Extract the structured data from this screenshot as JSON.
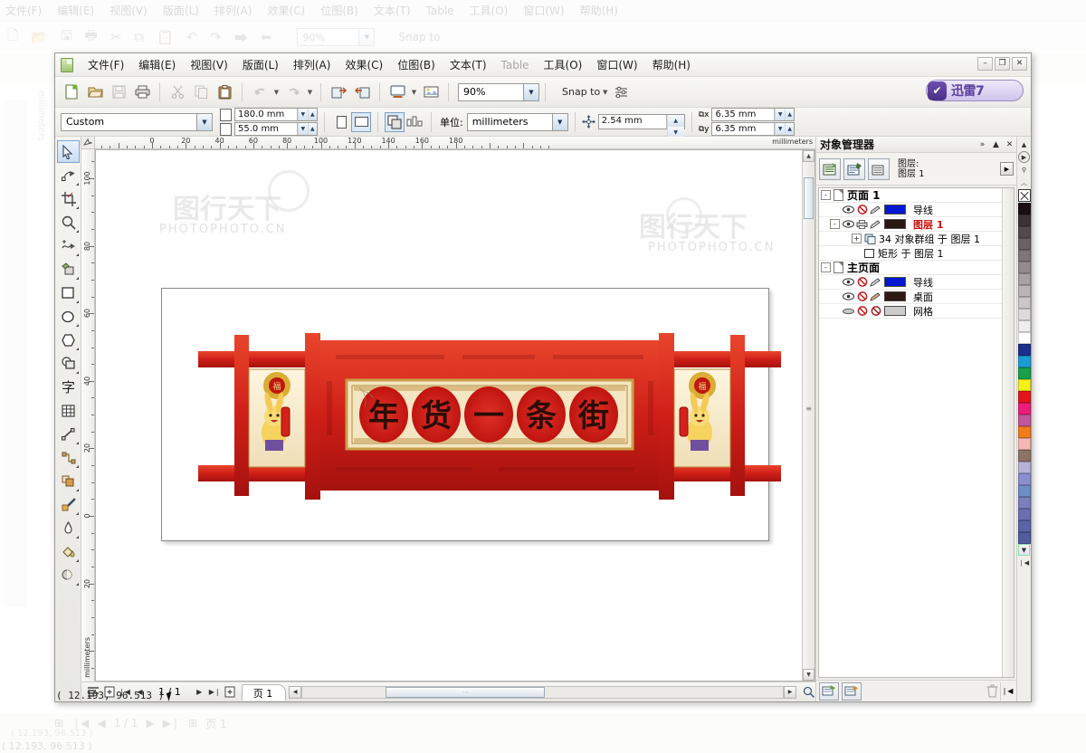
{
  "app": {
    "title_icon": "document-icon",
    "thunder_badge": {
      "text": "迅雷7",
      "mark": "✔"
    }
  },
  "menubar": {
    "items": [
      {
        "label": "文件(F)"
      },
      {
        "label": "编辑(E)"
      },
      {
        "label": "视图(V)"
      },
      {
        "label": "版面(L)"
      },
      {
        "label": "排列(A)"
      },
      {
        "label": "效果(C)"
      },
      {
        "label": "位图(B)"
      },
      {
        "label": "文本(T)"
      },
      {
        "label": "Table"
      },
      {
        "label": "工具(O)"
      },
      {
        "label": "窗口(W)"
      },
      {
        "label": "帮助(H)"
      }
    ],
    "window_buttons": [
      {
        "name": "minimize",
        "glyph": "–"
      },
      {
        "name": "restore",
        "glyph": "❐"
      },
      {
        "name": "close",
        "glyph": "✕"
      }
    ]
  },
  "toolbar": {
    "buttons": [
      {
        "name": "new-document-icon",
        "glyph": "🗋"
      },
      {
        "name": "open-document-icon",
        "glyph": "📂"
      },
      {
        "name": "save-icon",
        "glyph": "🖫"
      },
      {
        "name": "print-icon",
        "glyph": "🖶"
      },
      {
        "name": "cut-icon",
        "glyph": "✂"
      },
      {
        "name": "copy-icon",
        "glyph": "⧉"
      },
      {
        "name": "paste-icon",
        "glyph": "📋"
      },
      {
        "name": "undo-icon",
        "glyph": "↶"
      },
      {
        "name": "redo-icon",
        "glyph": "↷"
      },
      {
        "name": "import-icon",
        "glyph": "⮕"
      },
      {
        "name": "export-icon",
        "glyph": "⬅"
      },
      {
        "name": "application-launcher-icon",
        "glyph": "🖳"
      },
      {
        "name": "corel-online-icon",
        "glyph": "🖼"
      }
    ],
    "zoom_value": "90%",
    "snap_to_label": "Snap to",
    "options_icon": "options-icon"
  },
  "property_bar": {
    "paper_type": "Custom",
    "paper_width": "180.0 mm",
    "paper_height": "55.0 mm",
    "orientation_selected": "landscape",
    "units_label": "单位:",
    "units_value": "millimeters",
    "nudge_offset": "2.54 mm",
    "duplicate_x": "6.35 mm",
    "duplicate_y": "6.35 mm"
  },
  "toolbox": [
    {
      "name": "pick-tool",
      "glyph": "➤",
      "active": true,
      "flyout": false
    },
    {
      "name": "shape-tool",
      "glyph": "✥",
      "active": false,
      "flyout": true
    },
    {
      "name": "crop-tool",
      "glyph": "✂",
      "active": false,
      "flyout": true
    },
    {
      "name": "zoom-tool",
      "glyph": "🔍",
      "active": false,
      "flyout": true
    },
    {
      "name": "freehand-tool",
      "glyph": "✎",
      "active": false,
      "flyout": true
    },
    {
      "name": "smart-fill-tool",
      "glyph": "◈",
      "active": false,
      "flyout": true
    },
    {
      "name": "rectangle-tool",
      "glyph": "▭",
      "active": false,
      "flyout": true
    },
    {
      "name": "ellipse-tool",
      "glyph": "◯",
      "active": false,
      "flyout": true
    },
    {
      "name": "polygon-tool",
      "glyph": "⬡",
      "active": false,
      "flyout": true
    },
    {
      "name": "basic-shapes-tool",
      "glyph": "⬓",
      "active": false,
      "flyout": true
    },
    {
      "name": "text-tool",
      "glyph": "字",
      "active": false,
      "flyout": false
    },
    {
      "name": "table-tool",
      "glyph": "▦",
      "active": false,
      "flyout": false
    },
    {
      "name": "dimension-tool",
      "glyph": "⟋",
      "active": false,
      "flyout": true
    },
    {
      "name": "connector-tool",
      "glyph": "⌁",
      "active": false,
      "flyout": true
    },
    {
      "name": "blend-tool",
      "glyph": "❏",
      "active": false,
      "flyout": true
    },
    {
      "name": "eyedropper-tool",
      "glyph": "⚲",
      "active": false,
      "flyout": true
    },
    {
      "name": "outline-tool",
      "glyph": "✒",
      "active": false,
      "flyout": true
    },
    {
      "name": "fill-tool",
      "glyph": "🪣",
      "active": false,
      "flyout": true
    },
    {
      "name": "interactive-fill-tool",
      "glyph": "◐",
      "active": false,
      "flyout": true
    }
  ],
  "rulers": {
    "unit_label": "millimeters",
    "horizontal_ticks": [
      "0",
      "20",
      "40",
      "60",
      "80",
      "100",
      "120",
      "140",
      "160",
      "180"
    ],
    "vertical_ticks": [
      "100",
      "80",
      "60",
      "40",
      "20",
      "0",
      "20"
    ]
  },
  "artwork": {
    "title": "年货一条街",
    "characters": [
      "年",
      "货",
      "一",
      "条",
      "街"
    ],
    "description": "中国风红色年货一条街横幅，两侧兔子吉祥物"
  },
  "page_nav": {
    "first_label": "❘◀",
    "prev_label": "◀",
    "page_count": "1 / 1",
    "next_label": "▶",
    "last_label": "▶❘",
    "add_page_before_icon": "add-page-icon",
    "add_page_after_icon": "add-page-icon",
    "tab_label": "页 1"
  },
  "docker": {
    "title": "对象管理器",
    "header_buttons": [
      {
        "name": "docker-more",
        "glyph": "»"
      },
      {
        "name": "docker-collapse",
        "glyph": "▲"
      },
      {
        "name": "docker-close",
        "glyph": "✕"
      }
    ],
    "tool_buttons": [
      {
        "name": "show-object-properties-icon",
        "glyph": "▤"
      },
      {
        "name": "edit-across-layers-icon",
        "glyph": "▥"
      },
      {
        "name": "layer-manager-view-icon",
        "glyph": "▦"
      }
    ],
    "layer_caption_line1": "图层:",
    "layer_caption_line2": "图层 1",
    "expand_button": "▶",
    "tree": [
      {
        "name": "页面 1",
        "type": "page",
        "expander": "-",
        "children": [
          {
            "label": "导线",
            "type": "layer",
            "color": "#0018d0",
            "eye": "visible",
            "print": "no-print",
            "lock": "editable"
          },
          {
            "label": "图层 1",
            "type": "layer",
            "color": "#2a1612",
            "highlight": true,
            "eye": "visible",
            "print": "print",
            "lock": "editable",
            "children": [
              {
                "label": "34 对象群组 于 图层 1",
                "type": "group",
                "expander": "+"
              },
              {
                "label": "矩形 于 图层 1",
                "type": "rectangle"
              }
            ]
          }
        ]
      },
      {
        "name": "主页面",
        "type": "masterpage",
        "expander": "-",
        "children": [
          {
            "label": "导线",
            "type": "layer",
            "color": "#0018d0",
            "eye": "visible",
            "print": "no-print",
            "lock": "editable"
          },
          {
            "label": "桌面",
            "type": "layer",
            "color": "#2e1a12",
            "eye": "visible",
            "print": "no-print",
            "lock": "editable"
          },
          {
            "label": "网格",
            "type": "layer",
            "color": "#cccccc",
            "eye": "hidden",
            "print": "no-print",
            "lock": "locked"
          }
        ]
      }
    ],
    "footer_buttons": [
      {
        "name": "new-child-object-icon",
        "glyph": "▣"
      },
      {
        "name": "new-layer-icon",
        "glyph": "▤"
      }
    ],
    "delete_icon": "trash-icon",
    "collapse_icon": "❘◀"
  },
  "palette": {
    "top_buttons": [
      {
        "name": "palette-scroll-up-icon",
        "glyph": "▲"
      },
      {
        "name": "palette-menu-icon",
        "glyph": "▶"
      },
      {
        "name": "palette-pin-icon",
        "glyph": "⚲"
      },
      {
        "name": "palette-more-up-icon",
        "glyph": "︿"
      }
    ],
    "no-color": "none-swatch",
    "swatches": [
      "#1a1013",
      "#3c3336",
      "#55494c",
      "#6b6063",
      "#7f7579",
      "#938b8e",
      "#a7a1a3",
      "#b9b4b6",
      "#cbc8c9",
      "#dedbdc",
      "#efeeee",
      "#ffffff",
      "#1b2f8c",
      "#1c9ad6",
      "#17a04a",
      "#f5f018",
      "#e3141e",
      "#ec1c7a",
      "#c4559b",
      "#f07c1a",
      "#f6b8b5",
      "#8c7365",
      "#b7b3d8",
      "#8b8fd0",
      "#6d8ec6",
      "#7b7fbc",
      "#6a6fb1",
      "#5a64a8",
      "#4f5c9e"
    ],
    "scroll_down": "▼",
    "palette_home": "❘◀"
  },
  "status": {
    "coordinates": "( 12.193, 96.513 )"
  },
  "watermarks": [
    "图行天下",
    "PHOTOPHOTO.CN"
  ]
}
